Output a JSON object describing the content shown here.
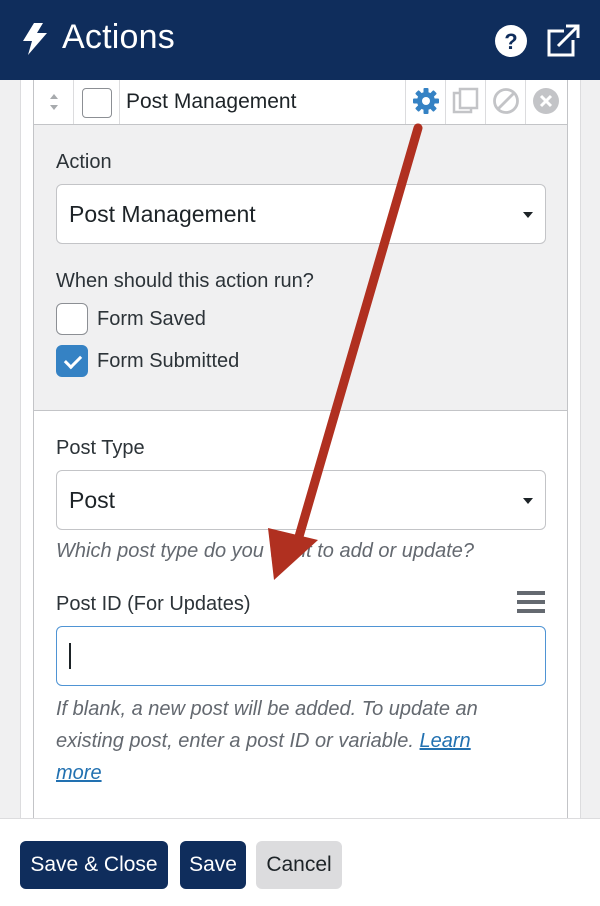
{
  "header": {
    "title": "Actions"
  },
  "action_row": {
    "name": "Post Management"
  },
  "settings": {
    "action_label": "Action",
    "action_value": "Post Management",
    "run_question": "When should this action run?",
    "triggers": [
      {
        "label": "Form Saved",
        "checked": false
      },
      {
        "label": "Form Submitted",
        "checked": true
      }
    ]
  },
  "post_type": {
    "label": "Post Type",
    "value": "Post",
    "help": "Which post type do you want to add or update?"
  },
  "post_id": {
    "label": "Post ID (For Updates)",
    "value": "",
    "help_line1": "If blank, a new post will be added. To update an",
    "help_line2": "existing post, enter a post ID or variable.",
    "link_part1": "Learn",
    "link_part2": "more"
  },
  "footer": {
    "save_close": "Save & Close",
    "save": "Save",
    "cancel": "Cancel"
  },
  "colors": {
    "header": "#0f2d5c",
    "accent": "#3582c4",
    "arrow": "#b03020"
  }
}
